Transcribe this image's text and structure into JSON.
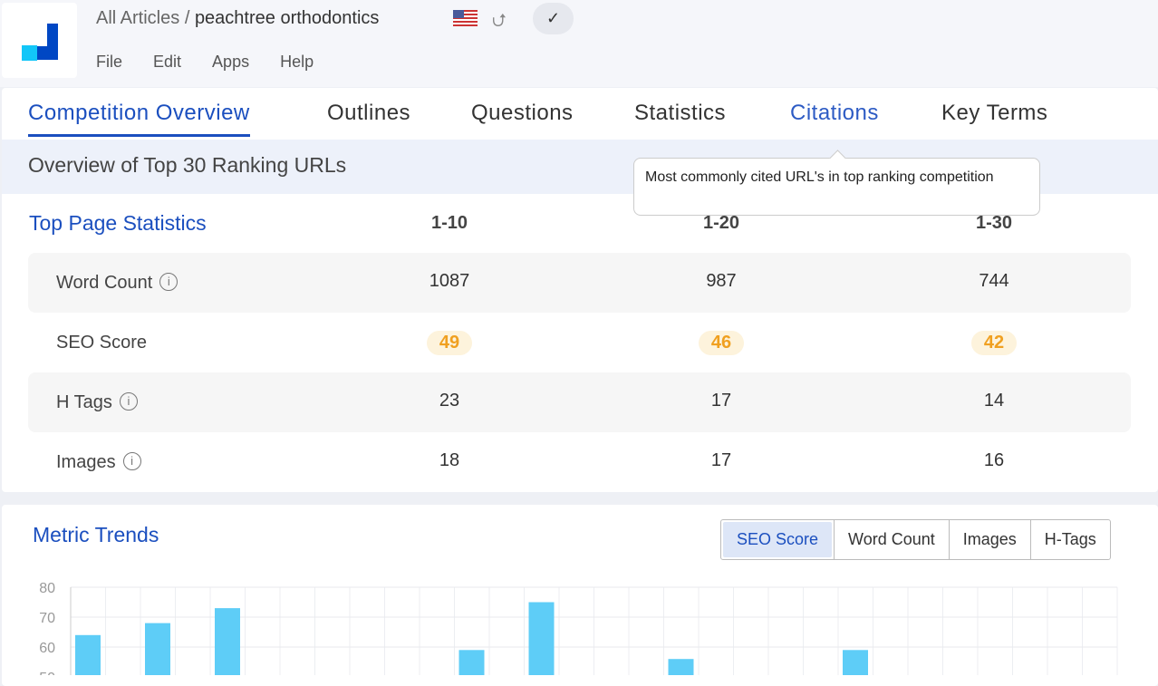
{
  "header": {
    "breadcrumb_root": "All Articles",
    "separator": "/",
    "article": "peachtree orthodontics",
    "flag_icon": "us-flag-icon",
    "share_icon": "share-icon",
    "check_icon": "check-icon"
  },
  "menu": [
    "File",
    "Edit",
    "Apps",
    "Help"
  ],
  "tabs": [
    "Competition Overview",
    "Outlines",
    "Questions",
    "Statistics",
    "Citations",
    "Key Terms"
  ],
  "active_tab": "Competition Overview",
  "overview_title": "Overview of Top 30 Ranking URLs",
  "tooltip": "Most commonly cited URL's in top ranking competition",
  "stats": {
    "title": "Top Page Statistics",
    "columns": [
      "1-10",
      "1-20",
      "1-30"
    ],
    "rows": [
      {
        "label": "Word Count",
        "info": true,
        "values": [
          "1087",
          "987",
          "744"
        ]
      },
      {
        "label": "SEO Score",
        "info": false,
        "values": [
          "49",
          "46",
          "42"
        ]
      },
      {
        "label": "H Tags",
        "info": true,
        "values": [
          "23",
          "17",
          "14"
        ]
      },
      {
        "label": "Images",
        "info": true,
        "values": [
          "18",
          "17",
          "16"
        ]
      }
    ]
  },
  "colors": {
    "accent": "#1b4fbf",
    "score": "#f0a020",
    "bar": "#5ecdf7"
  },
  "trends": {
    "title": "Metric Trends",
    "options": [
      "SEO Score",
      "Word Count",
      "Images",
      "H-Tags"
    ],
    "selected": "SEO Score"
  },
  "chart_data": {
    "type": "bar",
    "yticks": [
      80,
      70,
      60,
      50
    ],
    "ylim_top": 80,
    "grid": true,
    "values": [
      64,
      null,
      68,
      null,
      73,
      null,
      null,
      null,
      null,
      null,
      null,
      59,
      50.3,
      75,
      null,
      null,
      null,
      56,
      null,
      null,
      null,
      null,
      59,
      null,
      null,
      null,
      null,
      null,
      null,
      null
    ]
  }
}
